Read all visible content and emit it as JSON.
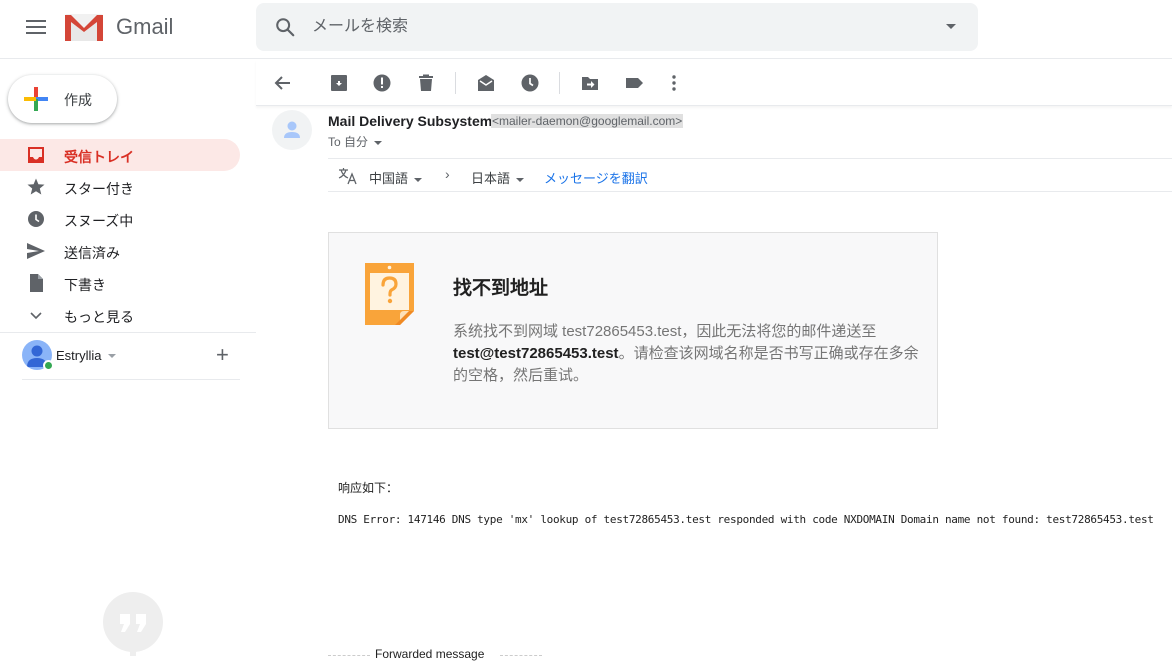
{
  "app": {
    "name": "Gmail",
    "colors": {
      "accent_red": "#d93025",
      "active_bg": "#fce8e6",
      "link_blue": "#1a73e8",
      "bounce_orange": "#f9a43a"
    }
  },
  "search": {
    "placeholder": "メールを検索",
    "icon": "search-icon"
  },
  "compose": {
    "label": "作成",
    "icon": "plus-icon"
  },
  "sidebar": {
    "items": [
      {
        "label": "受信トレイ",
        "icon": "inbox-icon",
        "active": true
      },
      {
        "label": "スター付き",
        "icon": "star-icon",
        "active": false
      },
      {
        "label": "スヌーズ中",
        "icon": "clock-icon",
        "active": false
      },
      {
        "label": "送信済み",
        "icon": "send-icon",
        "active": false
      },
      {
        "label": "下書き",
        "icon": "draft-icon",
        "active": false
      },
      {
        "label": "もっと見る",
        "icon": "chevron-down-icon",
        "active": false
      }
    ],
    "account": {
      "name": "Estryllia",
      "status": "online"
    }
  },
  "toolbar": {
    "buttons": [
      {
        "name": "back",
        "icon": "arrow-left-icon"
      },
      {
        "name": "archive",
        "icon": "archive-icon"
      },
      {
        "name": "report-spam",
        "icon": "report-icon"
      },
      {
        "name": "delete",
        "icon": "trash-icon"
      },
      {
        "name": "mark-unread",
        "icon": "mail-open-icon"
      },
      {
        "name": "snooze",
        "icon": "clock-icon"
      },
      {
        "name": "move-to",
        "icon": "folder-move-icon"
      },
      {
        "name": "labels",
        "icon": "label-icon"
      },
      {
        "name": "more",
        "icon": "more-vert-icon"
      }
    ]
  },
  "message": {
    "sender_name": "Mail Delivery Subsystem",
    "sender_email": "<mailer-daemon@googlemail.com>",
    "to_label": "To 自分"
  },
  "translate": {
    "from_lang": "中国語",
    "arrow": "›",
    "to_lang": "日本語",
    "action": "メッセージを翻訳"
  },
  "bounce": {
    "title": "找不到地址",
    "body_part1": "系统找不到网域 test72865453.test，因此无法将您的邮件递送至 ",
    "body_bold": "test@test72865453.test",
    "body_part2": "。请检查该网域名称是否书写正确或存在多余的空格，然后重试。"
  },
  "response": {
    "label": "响应如下：",
    "dns_error": "DNS Error: 147146 DNS type 'mx' lookup of test72865453.test responded with code NXDOMAIN Domain name not found: test72865453.test"
  },
  "forwarded": {
    "label": "Forwarded message"
  }
}
